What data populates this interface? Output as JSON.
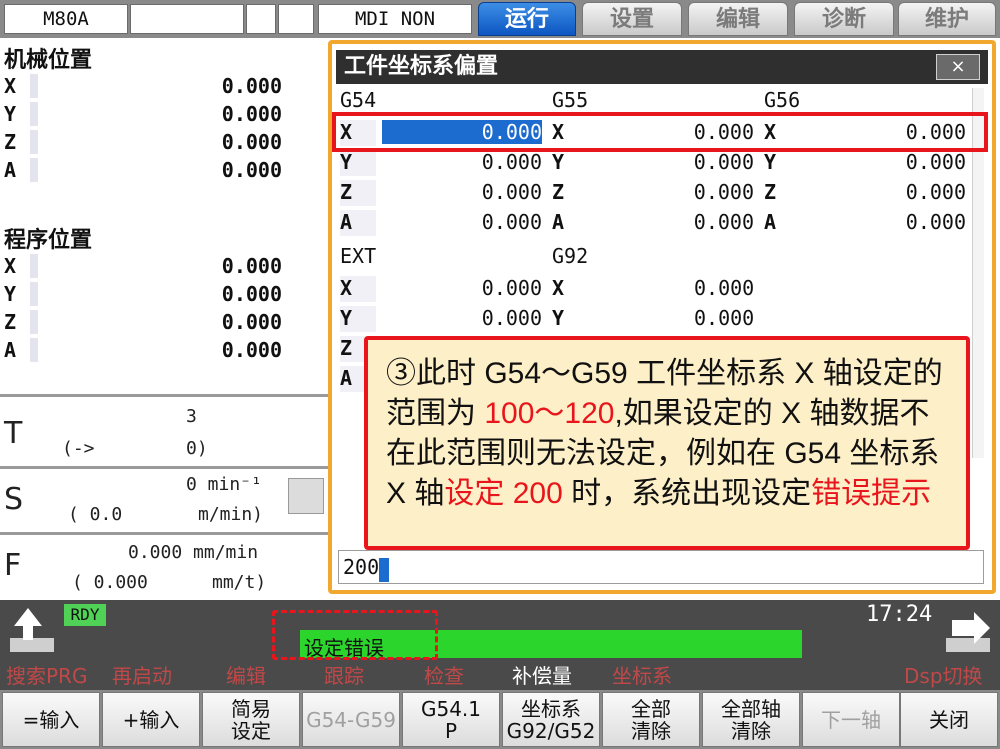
{
  "topbar": {
    "model": "M80A",
    "mode": "MDI NON",
    "tabs": [
      "运行",
      "设置",
      "编辑",
      "诊断",
      "维护"
    ],
    "active_tab": "运行"
  },
  "machine_position": {
    "title": "机械位置",
    "axes": [
      {
        "label": "X",
        "value": "0.000"
      },
      {
        "label": "Y",
        "value": "0.000"
      },
      {
        "label": "Z",
        "value": "0.000"
      },
      {
        "label": "A",
        "value": "0.000"
      }
    ]
  },
  "program_position": {
    "title": "程序位置",
    "axes": [
      {
        "label": "X",
        "value": "0.000"
      },
      {
        "label": "Y",
        "value": "0.000"
      },
      {
        "label": "Z",
        "value": "0.000"
      },
      {
        "label": "A",
        "value": "0.000"
      }
    ]
  },
  "tool": {
    "label": "T",
    "value": "3",
    "sub_left": "(->",
    "sub_right": "0)"
  },
  "spindle": {
    "label": "S",
    "value": "0 min⁻¹",
    "sub_left": "( 0.0",
    "sub_right": "m/min)"
  },
  "feed": {
    "label": "F",
    "value": "0.000 mm/min",
    "sub_left": "( 0.000",
    "sub_right": "mm/t)"
  },
  "dialog": {
    "title": "工件坐标系偏置",
    "close": "×",
    "groups": [
      "G54",
      "G55",
      "G56"
    ],
    "rows": [
      {
        "axis": "X",
        "values": [
          "0.000",
          "0.000",
          "0.000"
        ]
      },
      {
        "axis": "Y",
        "values": [
          "0.000",
          "0.000",
          "0.000"
        ]
      },
      {
        "axis": "Z",
        "values": [
          "0.000",
          "0.000",
          "0.000"
        ]
      },
      {
        "axis": "A",
        "values": [
          "0.000",
          "0.000",
          "0.000"
        ]
      }
    ],
    "ext_label": "EXT",
    "g92_label": "G92",
    "ext_rows": [
      {
        "axis": "X",
        "ext": "0.000",
        "g92": "0.000"
      },
      {
        "axis": "Y",
        "ext": "0.000",
        "g92": "0.000"
      },
      {
        "axis": "Z"
      },
      {
        "axis": "A"
      }
    ],
    "input_value": "200"
  },
  "callout": {
    "segments": [
      {
        "text": "③此时 G54～G59 工件坐标系 X 轴设定的范围为 ",
        "red": false
      },
      {
        "text": "100～120",
        "red": true
      },
      {
        "text": ",如果设定的 X 轴数据不在此范围则无法设定，例如在 G54 坐标系 X 轴",
        "red": false
      },
      {
        "text": "设定 200",
        "red": true
      },
      {
        "text": " 时，系统出现设定",
        "red": false
      },
      {
        "text": "错误提示",
        "red": true
      }
    ]
  },
  "status": {
    "ready": "RDY",
    "message": "设定错误",
    "time": "17:24"
  },
  "function_labels": [
    "搜索PRG",
    "再启动",
    "编辑",
    "跟踪",
    "检查",
    "补偿量",
    "坐标系",
    "Dsp切换"
  ],
  "softkeys": [
    "=输入",
    "+输入",
    "简易\n设定",
    "G54-G59",
    "G54.1\nP",
    "坐标系\nG92/G52",
    "全部\n清除",
    "全部轴\n清除",
    "下一轴",
    "关闭"
  ],
  "colors": {
    "accent": "#1c6cd0",
    "highlight": "#e8161c",
    "status_ok": "#2bd52b",
    "dialog_border": "#f2a72e"
  }
}
